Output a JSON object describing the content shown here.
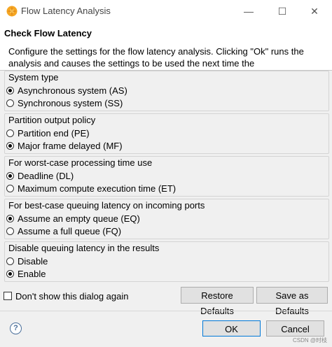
{
  "window": {
    "title": "Flow Latency Analysis",
    "minimize_glyph": "—",
    "maximize_glyph": "☐",
    "close_glyph": "✕"
  },
  "header": {
    "title": "Check Flow Latency",
    "description": "Configure the settings for the flow latency analysis.  Clicking \"Ok\" runs the analysis and causes the settings to be used the next time the"
  },
  "groups": [
    {
      "label": "System type",
      "options": [
        {
          "label": "Asynchronous system (AS)",
          "checked": true
        },
        {
          "label": "Synchronous system (SS)",
          "checked": false
        }
      ]
    },
    {
      "label": "Partition output policy",
      "options": [
        {
          "label": "Partition end (PE)",
          "checked": false
        },
        {
          "label": "Major frame delayed (MF)",
          "checked": true
        }
      ]
    },
    {
      "label": "For worst-case processing time use",
      "options": [
        {
          "label": "Deadline (DL)",
          "checked": true
        },
        {
          "label": "Maximum compute execution time (ET)",
          "checked": false
        }
      ]
    },
    {
      "label": "For best-case queuing latency on incoming ports",
      "options": [
        {
          "label": "Assume an empty queue (EQ)",
          "checked": true
        },
        {
          "label": "Assume a full queue (FQ)",
          "checked": false
        }
      ]
    },
    {
      "label": "Disable queuing latency in the results",
      "options": [
        {
          "label": "Disable",
          "checked": false
        },
        {
          "label": "Enable",
          "checked": true
        }
      ]
    }
  ],
  "dont_show": {
    "label": "Don't show this dialog again",
    "checked": false
  },
  "buttons": {
    "restore_defaults": "Restore Defaults",
    "save_as_defaults": "Save as Defaults",
    "ok": "OK",
    "cancel": "Cancel",
    "help_glyph": "?"
  },
  "watermark": "CSDN @时枝"
}
